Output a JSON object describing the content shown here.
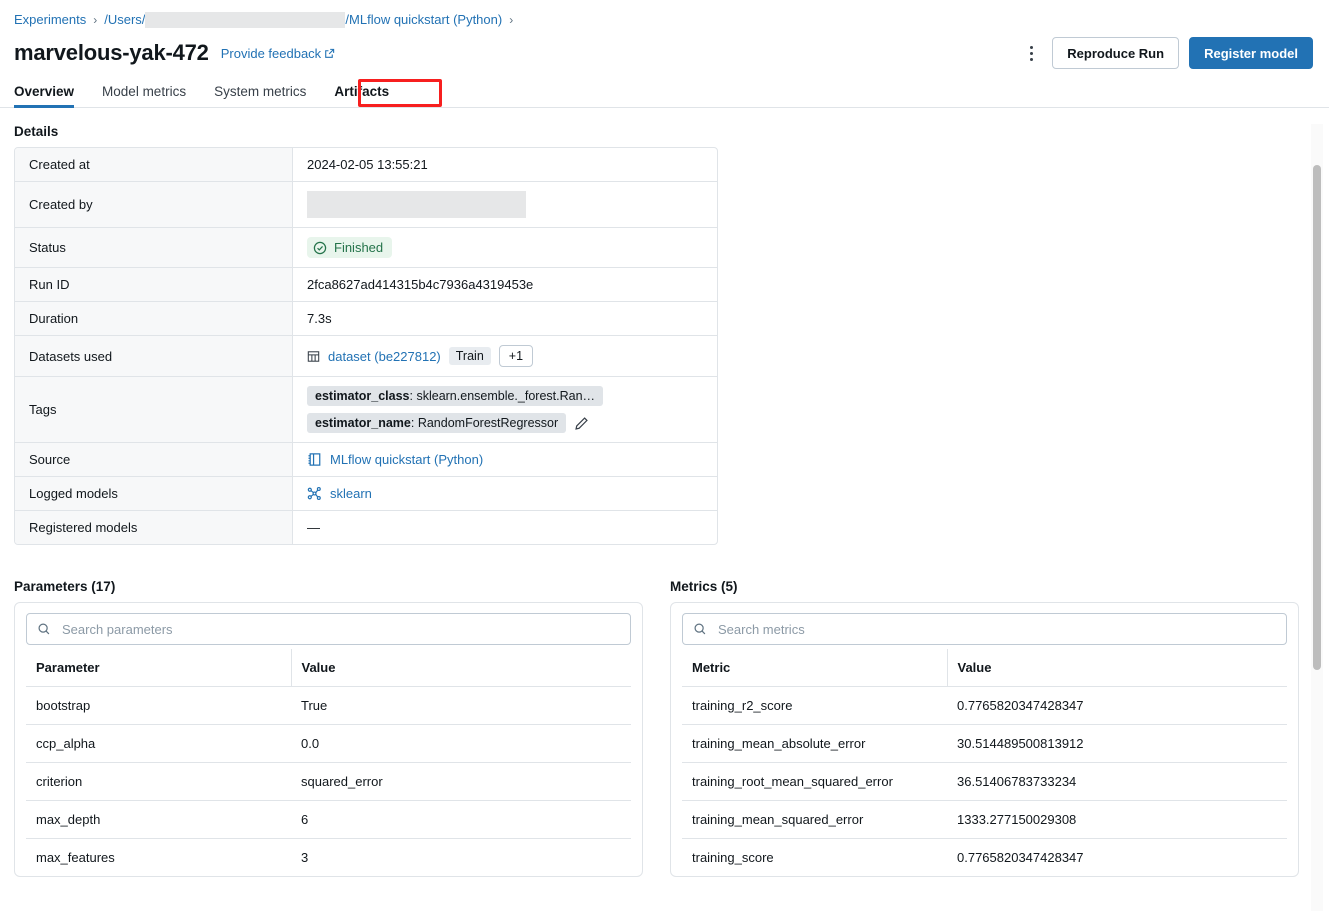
{
  "breadcrumb": {
    "root": "Experiments",
    "path_prefix": "/Users/",
    "path_redacted": true,
    "path_suffix": "/MLflow quickstart (Python)",
    "separator": "›"
  },
  "header": {
    "run_name": "marvelous-yak-472",
    "feedback_label": "Provide feedback",
    "kebab_label": "More options",
    "reproduce_label": "Reproduce Run",
    "register_label": "Register model",
    "primary_color": "#2272B4"
  },
  "tabs": [
    {
      "label": "Overview",
      "active": true,
      "highlighted": false
    },
    {
      "label": "Model metrics",
      "active": false,
      "highlighted": false
    },
    {
      "label": "System metrics",
      "active": false,
      "highlighted": false
    },
    {
      "label": "Artifacts",
      "active": false,
      "highlighted": true
    }
  ],
  "highlight": {
    "color": "#F71F1F"
  },
  "details": {
    "title": "Details",
    "rows": [
      {
        "label": "Created at",
        "type": "text",
        "value": "2024-02-05 13:55:21"
      },
      {
        "label": "Created by",
        "type": "redacted",
        "value": ""
      },
      {
        "label": "Status",
        "type": "status",
        "value": "Finished",
        "status_color": "#24734A"
      },
      {
        "label": "Run ID",
        "type": "text",
        "value": "2fca8627ad414315b4c7936a4319453e"
      },
      {
        "label": "Duration",
        "type": "text",
        "value": "7.3s"
      },
      {
        "label": "Datasets used",
        "type": "dataset",
        "dataset_link": "dataset (be227812)",
        "dataset_tag": "Train",
        "more_count": "+1"
      },
      {
        "label": "Tags",
        "type": "tags",
        "tags": [
          {
            "key": "estimator_class",
            "value": "sklearn.ensemble._forest.Ran…"
          },
          {
            "key": "estimator_name",
            "value": "RandomForestRegressor"
          }
        ]
      },
      {
        "label": "Source",
        "type": "link_icon",
        "value": "MLflow quickstart (Python)",
        "icon": "notebook-icon"
      },
      {
        "label": "Logged models",
        "type": "link_icon",
        "value": "sklearn",
        "icon": "model-icon"
      },
      {
        "label": "Registered models",
        "type": "text",
        "value": "—"
      }
    ]
  },
  "parameters": {
    "title": "Parameters (17)",
    "search_placeholder": "Search parameters",
    "search_value": "",
    "columns": [
      "Parameter",
      "Value"
    ],
    "rows": [
      {
        "name": "bootstrap",
        "value": "True"
      },
      {
        "name": "ccp_alpha",
        "value": "0.0"
      },
      {
        "name": "criterion",
        "value": "squared_error"
      },
      {
        "name": "max_depth",
        "value": "6"
      },
      {
        "name": "max_features",
        "value": "3"
      }
    ]
  },
  "metrics": {
    "title": "Metrics (5)",
    "search_placeholder": "Search metrics",
    "search_value": "",
    "columns": [
      "Metric",
      "Value"
    ],
    "rows": [
      {
        "name": "training_r2_score",
        "value": "0.7765820347428347"
      },
      {
        "name": "training_mean_absolute_error",
        "value": "30.514489500813912"
      },
      {
        "name": "training_root_mean_squared_error",
        "value": "36.51406783733234"
      },
      {
        "name": "training_mean_squared_error",
        "value": "1333.277150029308"
      },
      {
        "name": "training_score",
        "value": "0.7765820347428347"
      }
    ]
  }
}
